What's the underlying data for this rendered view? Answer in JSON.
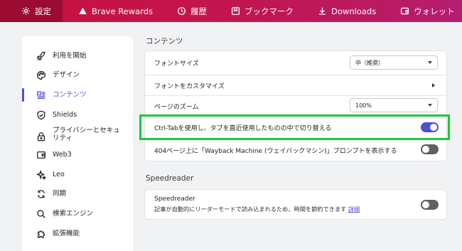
{
  "topbar": {
    "tabs": [
      {
        "label": "設定",
        "icon": "gear-icon",
        "active": true
      },
      {
        "label": "Brave Rewards",
        "icon": "triangle-icon"
      },
      {
        "label": "履歴",
        "icon": "history-icon"
      },
      {
        "label": "ブックマーク",
        "icon": "bookmark-icon"
      },
      {
        "label": "Downloads",
        "icon": "download-icon"
      },
      {
        "label": "ウォレット",
        "icon": "wallet-icon"
      }
    ]
  },
  "sidebar": {
    "items": [
      {
        "label": "利用を開始",
        "icon": "rocket-icon"
      },
      {
        "label": "デザイン",
        "icon": "palette-icon"
      },
      {
        "label": "コンテンツ",
        "icon": "content-icon",
        "active": true
      },
      {
        "label": "Shields",
        "icon": "shield-icon"
      },
      {
        "label": "プライバシーとセキュ",
        "label2": "リティ",
        "icon": "lock-icon"
      },
      {
        "label": "Web3",
        "icon": "wallet-icon"
      },
      {
        "label": "Leo",
        "icon": "sparkle-icon"
      },
      {
        "label": "同期",
        "icon": "sync-icon"
      },
      {
        "label": "検索エンジン",
        "icon": "search-icon"
      },
      {
        "label": "拡張機能",
        "icon": "puzzle-icon"
      }
    ]
  },
  "content_section": {
    "title": "コンテンツ",
    "font_size_label": "フォントサイズ",
    "font_size_value": "中（推奨）",
    "customize_fonts_label": "フォントをカスタマイズ",
    "page_zoom_label": "ページのズーム",
    "page_zoom_value": "100%",
    "ctrl_tab_label": "Ctrl-Tabを使用し、タブを直近使用したものの中で切り替える",
    "ctrl_tab_enabled": true,
    "wayback_label": "404ページ上に「Wayback Machine (ウェイバックマシン)」プロンプトを表示する",
    "wayback_enabled": false
  },
  "speedreader_section": {
    "title": "Speedreader",
    "label": "Speedreader",
    "description": "記事が自動的にリーダーモードで読み込まれるため、時間を節約できます",
    "link": "詳細",
    "enabled": false
  },
  "colors": {
    "accent": "#4d4fd6",
    "topbar_start": "#c8103d",
    "topbar_end": "#b51d70",
    "highlight": "#1fc63e"
  }
}
